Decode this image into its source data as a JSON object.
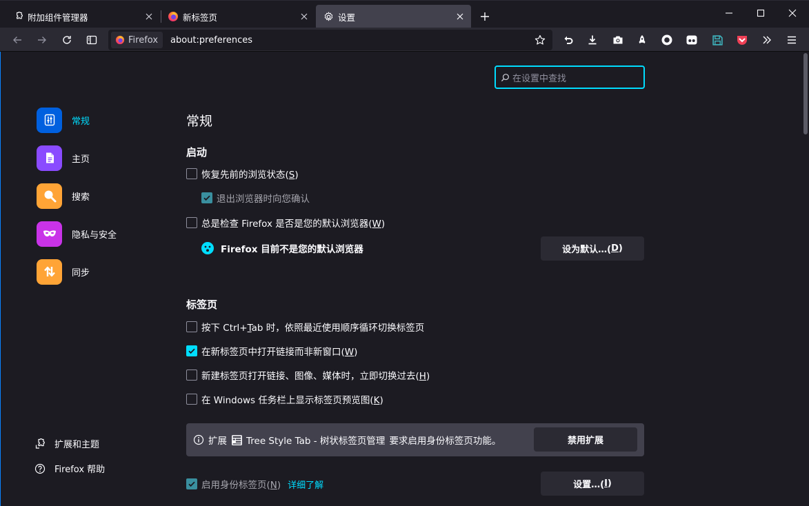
{
  "window": {
    "tabs": [
      {
        "label": "附加组件管理器",
        "icon": "puzzle-icon",
        "active": false
      },
      {
        "label": "新标签页",
        "icon": "firefox-logo-icon",
        "active": false
      },
      {
        "label": "设置",
        "icon": "gear-icon",
        "active": true
      }
    ],
    "controls": [
      "minimize-icon",
      "maximize-icon",
      "close-icon"
    ]
  },
  "navbar": {
    "identity_label": "Firefox",
    "url": "about:preferences",
    "toolbar_icons": [
      "undo-close-icon",
      "download-icon",
      "screenshot-icon",
      "rocket-icon",
      "circle-icon",
      "mask-icon",
      "save-icon",
      "pocket-icon",
      "overflow-chevron-icon",
      "menu-icon"
    ]
  },
  "search": {
    "placeholder": "在设置中查找"
  },
  "sidebar": {
    "categories": [
      {
        "label": "常规",
        "icon": "general-icon",
        "color": "#0060df",
        "selected": true
      },
      {
        "label": "主页",
        "icon": "home-page-icon",
        "color": "#8a4bff"
      },
      {
        "label": "搜索",
        "icon": "search-icon",
        "color": "#ffa436"
      },
      {
        "label": "隐私与安全",
        "icon": "privacy-mask-icon",
        "color": "#c933e8"
      },
      {
        "label": "同步",
        "icon": "sync-icon",
        "color": "#ffa436"
      }
    ],
    "footer": [
      {
        "label": "扩展和主题",
        "icon": "puzzle-icon"
      },
      {
        "label": "Firefox 帮助",
        "icon": "help-icon"
      }
    ]
  },
  "main": {
    "title": "常规",
    "startup": {
      "heading": "启动",
      "restore_session": {
        "text": "恢复先前的浏览状态(",
        "key": "S",
        "tail": ")",
        "checked": false
      },
      "warn_quit": {
        "text": "退出浏览器时向您确认",
        "checked": true
      },
      "check_default": {
        "text": "总是检查 Firefox 是否是您的默认浏览器(",
        "key": "W",
        "tail": ")",
        "checked": false
      },
      "not_default_msg": "Firefox 目前不是您的默认浏览器",
      "set_default_button": "设为默认…(",
      "set_default_key": "D",
      "set_default_tail": ")"
    },
    "tabs": {
      "heading": "标签页",
      "ctrl_tab": {
        "pre": "按下 Ctrl+",
        "key": "T",
        "post": "ab 时，依照最近使用顺序循环切换标签页",
        "checked": false
      },
      "open_in_tabs": {
        "text": "在新标签页中打开链接而非新窗口(",
        "key": "W",
        "tail": ")",
        "checked": true
      },
      "switch_to_tab": {
        "text": "新建标签页打开链接、图像、媒体时，立即切换过去(",
        "key": "H",
        "tail": ")",
        "checked": false
      },
      "taskbar_preview": {
        "text": "在 Windows 任务栏上显示标签页预览图(",
        "key": "K",
        "tail": ")",
        "checked": false
      },
      "extension_notice": {
        "prefix": "扩展",
        "ext_name": "Tree Style Tab - 树状标签页管理",
        "suffix": "要求启用身份标签页功能。",
        "button": "禁用扩展"
      },
      "containers": {
        "text": "启用身份标签页(",
        "key": "N",
        "tail": ")",
        "checked": true,
        "learn_more": "详细了解",
        "settings_button": "设置…(",
        "settings_key": "I",
        "settings_tail": ")"
      }
    }
  },
  "colors": {
    "accent": "#00ddff",
    "background": "#1c1b22",
    "surface": "#2b2a33",
    "tab_active": "#42414d"
  }
}
